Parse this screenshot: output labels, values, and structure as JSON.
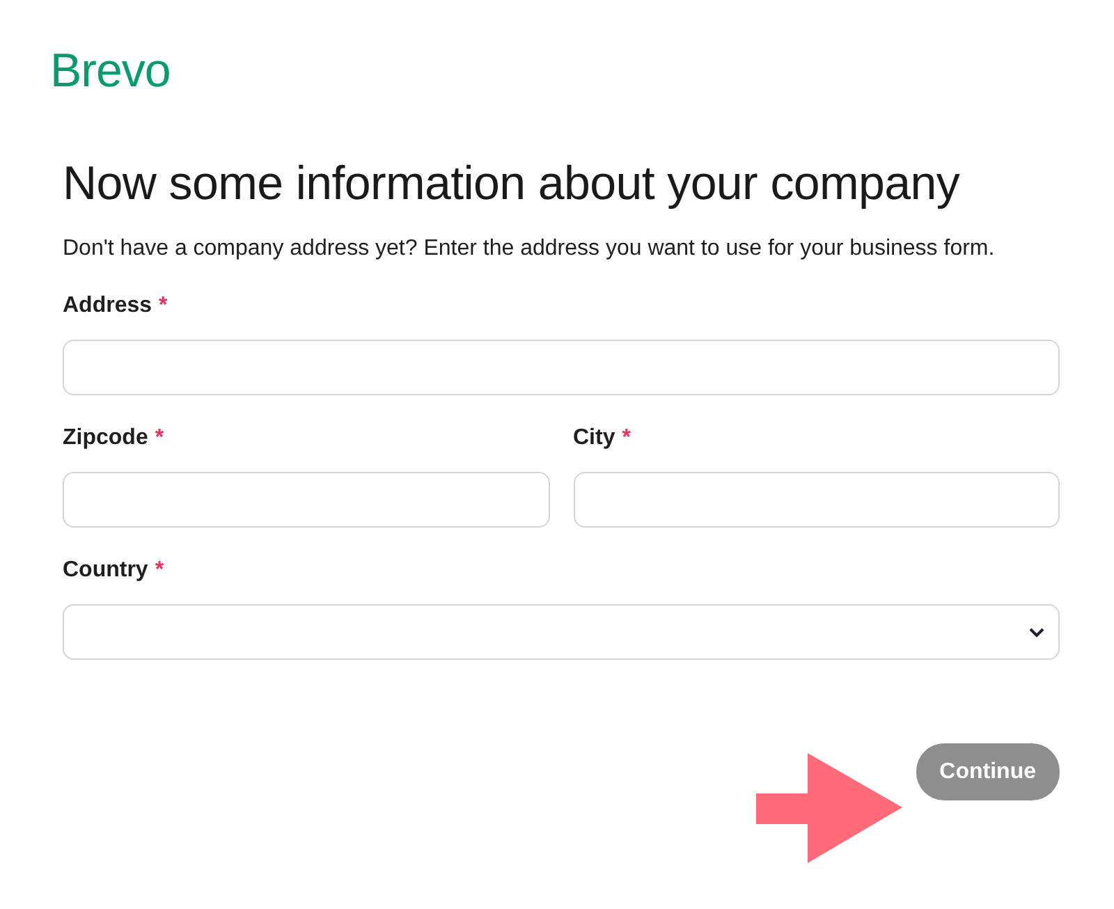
{
  "logo": "Brevo",
  "title": "Now some information about your company",
  "subtitle": "Don't have a company address yet? Enter the address you want to use for your business form.",
  "form_rows": [
    [
      {
        "label": "Address",
        "required_mark": "*",
        "kind": "text"
      }
    ],
    [
      {
        "label": "Zipcode",
        "required_mark": "*",
        "kind": "text"
      },
      {
        "label": "City",
        "required_mark": "*",
        "kind": "text"
      }
    ],
    [
      {
        "label": "Country",
        "required_mark": "*",
        "kind": "select"
      }
    ]
  ],
  "continue_button": {
    "label": "Continue",
    "disabled": true
  },
  "annotation": {
    "kind": "arrow"
  }
}
